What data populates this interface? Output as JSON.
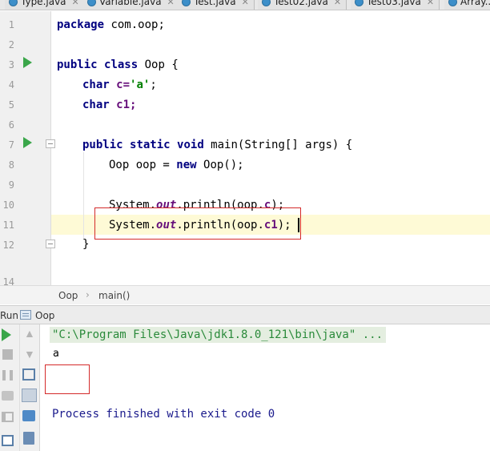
{
  "tabs": [
    {
      "label": "Type.java"
    },
    {
      "label": "Variable.java"
    },
    {
      "label": "Test.java"
    },
    {
      "label": "Test02.java"
    },
    {
      "label": "Test03.java"
    },
    {
      "label": "Array..."
    }
  ],
  "editor": {
    "line_numbers": [
      "1",
      "2",
      "3",
      "4",
      "5",
      "6",
      "7",
      "8",
      "9",
      "10",
      "11",
      "12",
      "14"
    ],
    "code": {
      "l1_kw": "package",
      "l1_rest": " com.oop;",
      "l3_kw1": "public",
      "l3_kw2": "class",
      "l3_rest": " Oop {",
      "l4_kw": "char",
      "l4_var": " c=",
      "l4_str": "'a'",
      "l4_end": ";",
      "l5_kw": "char",
      "l5_var": " c1;",
      "l7_kw1": "public",
      "l7_kw2": "static",
      "l7_kw3": "void",
      "l7_rest": " main(String[] args) {",
      "l8_pre": "Oop oop = ",
      "l8_kw": "new",
      "l8_rest": " Oop();",
      "l10_pre": "System.",
      "l10_out": "out",
      "l10_mid": ".println(oop.",
      "l10_fld": "c",
      "l10_end": ");",
      "l11_pre": "System.",
      "l11_out": "out",
      "l11_mid": ".println(oop.",
      "l11_fld": "c1",
      "l11_end": ");",
      "l12": "}"
    }
  },
  "breadcrumb": {
    "class_name": "Oop",
    "separator": "›",
    "method_name": "main()"
  },
  "run_panel": {
    "label": "Run",
    "config_name": "Oop",
    "command": "\"C:\\Program Files\\Java\\jdk1.8.0_121\\bin\\java\" ...",
    "output_line": "a",
    "exit_message": "Process finished with exit code 0"
  },
  "colors": {
    "highlight_box": "#d42a2a",
    "run_green": "#3aa64a",
    "current_line": "#fefad6"
  },
  "icons": [
    "run-gutter-icon",
    "fold-icon",
    "rerun-icon",
    "stop-icon",
    "pause-icon",
    "camera-icon",
    "exit-icon",
    "layout-icon",
    "up-arrow-icon",
    "down-arrow-icon",
    "soft-wrap-icon",
    "scroll-to-end-icon",
    "print-icon",
    "trash-icon"
  ]
}
